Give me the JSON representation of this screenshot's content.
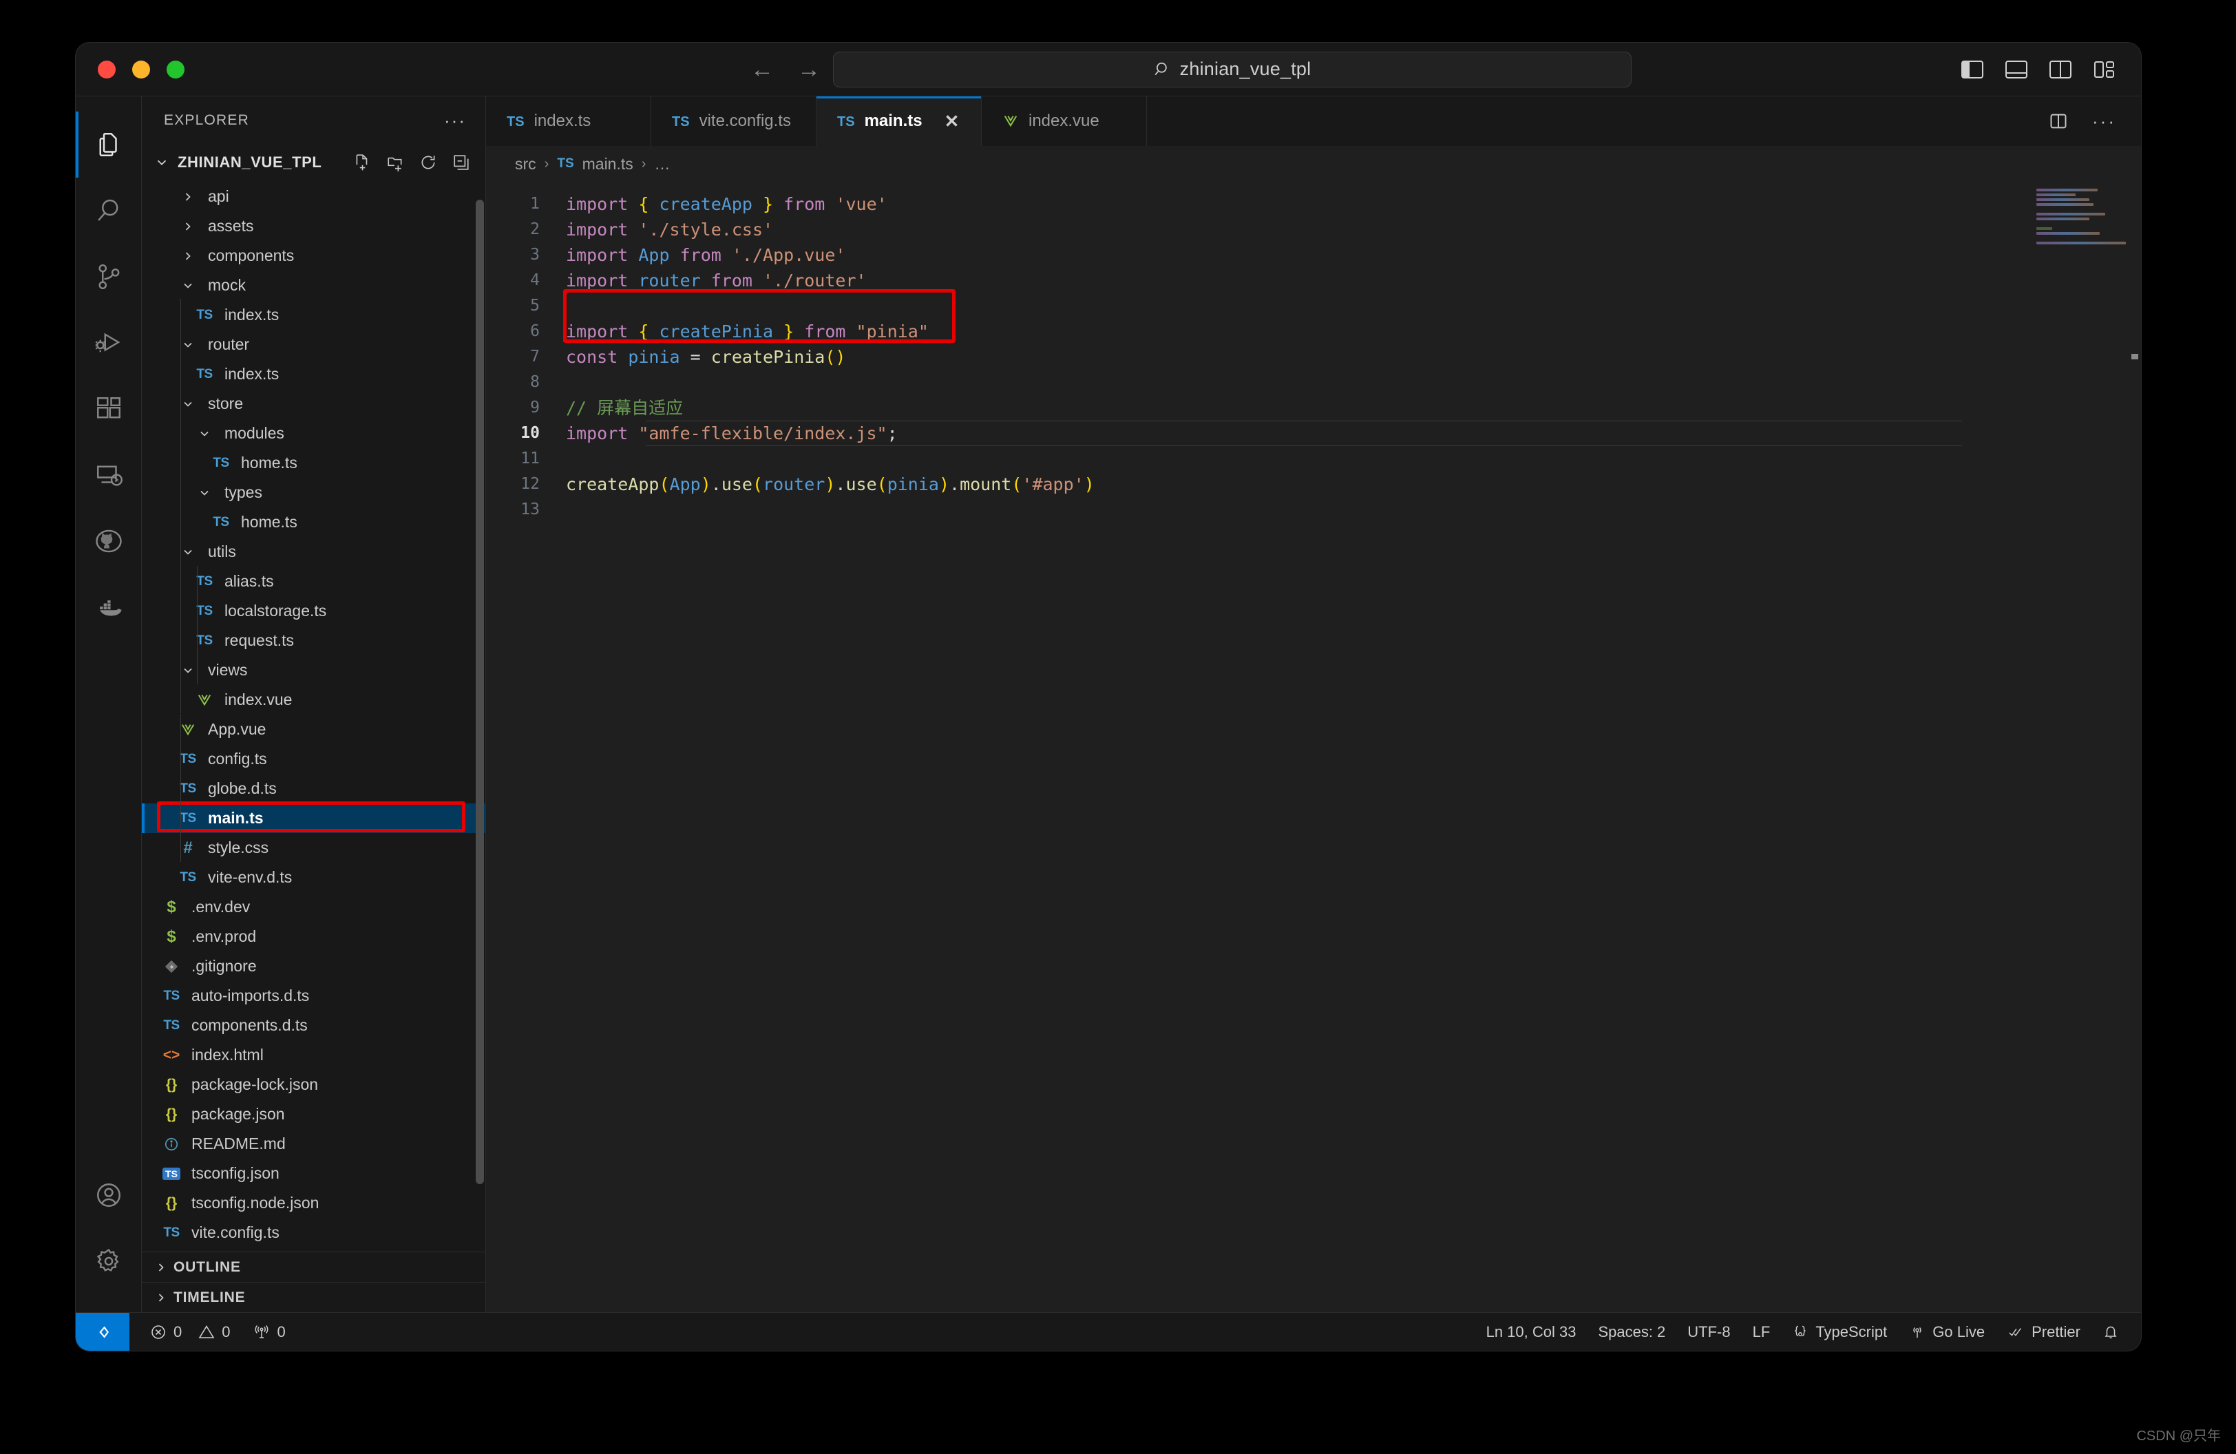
{
  "window": {
    "traffic_lights": [
      "close",
      "minimize",
      "maximize"
    ],
    "quick_input": {
      "value": "zhinian_vue_tpl",
      "icon": "search-icon"
    },
    "nav_back": "←",
    "nav_forward": "→",
    "layout_toggles": [
      "toggle-primary-sidebar",
      "toggle-panel",
      "toggle-secondary-sidebar",
      "customize-layout"
    ]
  },
  "activitybar": {
    "items": [
      {
        "name": "explorer",
        "icon": "files-icon",
        "active": true
      },
      {
        "name": "search",
        "icon": "search-icon",
        "active": false
      },
      {
        "name": "source-control",
        "icon": "source-control-icon",
        "active": false
      },
      {
        "name": "run-and-debug",
        "icon": "debug-icon",
        "active": false
      },
      {
        "name": "extensions",
        "icon": "extensions-icon",
        "active": false
      },
      {
        "name": "remote-explorer",
        "icon": "remote-explorer-icon",
        "active": false
      },
      {
        "name": "github",
        "icon": "github-icon",
        "active": false
      },
      {
        "name": "docker",
        "icon": "docker-icon",
        "active": false
      }
    ],
    "bottom_items": [
      {
        "name": "accounts",
        "icon": "account-icon"
      },
      {
        "name": "manage",
        "icon": "gear-icon"
      }
    ]
  },
  "sidebar": {
    "title": "EXPLORER",
    "more_actions": "···",
    "folder": {
      "name": "ZHINIAN_VUE_TPL",
      "expanded": true,
      "actions": [
        "new-file-icon",
        "new-folder-icon",
        "refresh-icon",
        "collapse-all-icon"
      ]
    },
    "tree": [
      {
        "label": "api",
        "type": "folder",
        "icon": "chevron-right",
        "depth": 1,
        "expanded": false
      },
      {
        "label": "assets",
        "type": "folder",
        "icon": "chevron-right",
        "depth": 1,
        "expanded": false
      },
      {
        "label": "components",
        "type": "folder",
        "icon": "chevron-right",
        "depth": 1,
        "expanded": false
      },
      {
        "label": "mock",
        "type": "folder",
        "icon": "chevron-down",
        "depth": 1,
        "expanded": true
      },
      {
        "label": "index.ts",
        "type": "file",
        "icon": "ts-icon",
        "depth": 2
      },
      {
        "label": "router",
        "type": "folder",
        "icon": "chevron-down",
        "depth": 1,
        "expanded": true
      },
      {
        "label": "index.ts",
        "type": "file",
        "icon": "ts-icon",
        "depth": 2
      },
      {
        "label": "store",
        "type": "folder",
        "icon": "chevron-down",
        "depth": 1,
        "expanded": true
      },
      {
        "label": "modules",
        "type": "folder",
        "icon": "chevron-down",
        "depth": 2,
        "expanded": true
      },
      {
        "label": "home.ts",
        "type": "file",
        "icon": "ts-icon",
        "depth": 3
      },
      {
        "label": "types",
        "type": "folder",
        "icon": "chevron-down",
        "depth": 2,
        "expanded": true
      },
      {
        "label": "home.ts",
        "type": "file",
        "icon": "ts-icon",
        "depth": 3
      },
      {
        "label": "utils",
        "type": "folder",
        "icon": "chevron-down",
        "depth": 1,
        "expanded": true
      },
      {
        "label": "alias.ts",
        "type": "file",
        "icon": "ts-icon",
        "depth": 2
      },
      {
        "label": "localstorage.ts",
        "type": "file",
        "icon": "ts-icon",
        "depth": 2
      },
      {
        "label": "request.ts",
        "type": "file",
        "icon": "ts-icon",
        "depth": 2
      },
      {
        "label": "views",
        "type": "folder",
        "icon": "chevron-down",
        "depth": 1,
        "expanded": true
      },
      {
        "label": "index.vue",
        "type": "file",
        "icon": "vue-icon",
        "depth": 2
      },
      {
        "label": "App.vue",
        "type": "file",
        "icon": "vue-icon",
        "depth": 1
      },
      {
        "label": "config.ts",
        "type": "file",
        "icon": "ts-icon",
        "depth": 1
      },
      {
        "label": "globe.d.ts",
        "type": "file",
        "icon": "ts-icon",
        "depth": 1
      },
      {
        "label": "main.ts",
        "type": "file",
        "icon": "ts-icon",
        "depth": 1,
        "selected": true,
        "highlighted": true
      },
      {
        "label": "style.css",
        "type": "file",
        "icon": "css-icon",
        "depth": 1
      },
      {
        "label": "vite-env.d.ts",
        "type": "file",
        "icon": "ts-icon",
        "depth": 1
      },
      {
        "label": ".env.dev",
        "type": "file",
        "icon": "env-icon",
        "depth": 0
      },
      {
        "label": ".env.prod",
        "type": "file",
        "icon": "env-icon",
        "depth": 0
      },
      {
        "label": ".gitignore",
        "type": "file",
        "icon": "git-icon",
        "depth": 0
      },
      {
        "label": "auto-imports.d.ts",
        "type": "file",
        "icon": "ts-icon",
        "depth": 0
      },
      {
        "label": "components.d.ts",
        "type": "file",
        "icon": "ts-icon",
        "depth": 0
      },
      {
        "label": "index.html",
        "type": "file",
        "icon": "html-icon",
        "depth": 0
      },
      {
        "label": "package-lock.json",
        "type": "file",
        "icon": "json-icon",
        "depth": 0
      },
      {
        "label": "package.json",
        "type": "file",
        "icon": "json-icon",
        "depth": 0
      },
      {
        "label": "README.md",
        "type": "file",
        "icon": "readme-icon",
        "depth": 0
      },
      {
        "label": "tsconfig.json",
        "type": "file",
        "icon": "tsconfig-icon",
        "depth": 0
      },
      {
        "label": "tsconfig.node.json",
        "type": "file",
        "icon": "json-icon",
        "depth": 0
      },
      {
        "label": "vite.config.ts",
        "type": "file",
        "icon": "ts-icon",
        "depth": 0
      }
    ],
    "sections": [
      {
        "label": "OUTLINE",
        "expanded": false,
        "icon": "chevron-right"
      },
      {
        "label": "TIMELINE",
        "expanded": false,
        "icon": "chevron-right"
      }
    ]
  },
  "editor": {
    "tabs": [
      {
        "label": "index.ts",
        "icon": "ts-icon",
        "active": false,
        "has_close": false
      },
      {
        "label": "vite.config.ts",
        "icon": "ts-icon",
        "active": false,
        "has_close": false
      },
      {
        "label": "main.ts",
        "icon": "ts-icon",
        "active": true,
        "has_close": true,
        "close": "✕"
      },
      {
        "label": "index.vue",
        "icon": "vue-icon",
        "active": false,
        "has_close": false
      }
    ],
    "tab_actions": [
      "split-editor-icon",
      "more-actions-icon"
    ],
    "breadcrumb": [
      {
        "label": "src",
        "icon": ""
      },
      {
        "label": "main.ts",
        "icon": "ts-icon"
      },
      {
        "label": "…",
        "icon": ""
      }
    ],
    "breadcrumb_separator": "›",
    "lines": [
      {
        "num": "1",
        "text": "import { createApp } from 'vue'"
      },
      {
        "num": "2",
        "text": "import './style.css'"
      },
      {
        "num": "3",
        "text": "import App from './App.vue'"
      },
      {
        "num": "4",
        "text": "import router from './router'"
      },
      {
        "num": "5",
        "text": ""
      },
      {
        "num": "6",
        "text": "import { createPinia } from \"pinia\""
      },
      {
        "num": "7",
        "text": "const pinia = createPinia()"
      },
      {
        "num": "8",
        "text": ""
      },
      {
        "num": "9",
        "text": "// 屏幕自适应"
      },
      {
        "num": "10",
        "text": "import \"amfe-flexible/index.js\";",
        "current": true
      },
      {
        "num": "11",
        "text": ""
      },
      {
        "num": "12",
        "text": "createApp(App).use(router).use(pinia).mount('#app')"
      },
      {
        "num": "13",
        "text": ""
      }
    ],
    "annotation": {
      "type": "red-rectangle",
      "color": "#e60000",
      "covers_lines": [
        "9",
        "10"
      ]
    }
  },
  "statusbar": {
    "remote_icon": "remote-window-icon",
    "left": [
      {
        "name": "errors",
        "icon": "error-icon",
        "value": "0"
      },
      {
        "name": "warnings",
        "icon": "warning-icon",
        "value": "0"
      },
      {
        "name": "ports",
        "icon": "radio-tower-icon",
        "value": "0"
      }
    ],
    "right": [
      {
        "name": "cursor-position",
        "label": "Ln 10, Col 33"
      },
      {
        "name": "indentation",
        "label": "Spaces: 2"
      },
      {
        "name": "encoding",
        "label": "UTF-8"
      },
      {
        "name": "eol",
        "label": "LF"
      },
      {
        "name": "language-mode",
        "label": "TypeScript",
        "icon": "ts-braces-icon"
      },
      {
        "name": "go-live",
        "label": "Go Live",
        "icon": "broadcast-icon"
      },
      {
        "name": "prettier",
        "label": "Prettier",
        "icon": "check-check-icon"
      },
      {
        "name": "notifications",
        "label": "",
        "icon": "bell-icon"
      }
    ]
  },
  "watermark": "CSDN @只年",
  "colors": {
    "accent": "#0078d4",
    "annotation": "#e60000",
    "selection": "#04395e",
    "sidebar_bg": "#181818",
    "editor_bg": "#1f1f1f"
  }
}
